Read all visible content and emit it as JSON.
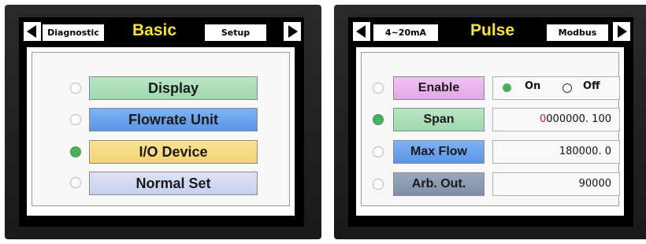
{
  "left_panel": {
    "header": {
      "prev_tab": "Diagnostic",
      "title": "Basic",
      "next_tab": "Setup"
    },
    "menu": [
      {
        "label": "Display",
        "selected": false,
        "color": "#a8dfb6"
      },
      {
        "label": "Flowrate Unit",
        "selected": false,
        "color": "#6aa3ee"
      },
      {
        "label": "I/O Device",
        "selected": true,
        "color": "#f7da83"
      },
      {
        "label": "Normal Set",
        "selected": false,
        "color": "#d3daf2"
      }
    ]
  },
  "right_panel": {
    "header": {
      "prev_tab": "4~20mA",
      "title": "Pulse",
      "next_tab": "Modbus"
    },
    "rows": [
      {
        "label": "Enable",
        "selected": false,
        "color": "#eab5ee"
      },
      {
        "label": "Span",
        "selected": true,
        "color": "#a8dfb6"
      },
      {
        "label": "Max Flow",
        "selected": false,
        "color": "#6aa3ee"
      },
      {
        "label": "Arb. Out.",
        "selected": false,
        "color": "#8a98b1"
      }
    ],
    "enable_options": {
      "on_label": "On",
      "off_label": "Off",
      "selected": "On"
    },
    "span_value": {
      "cursor_digit": "0",
      "rest": "000000. 100"
    },
    "max_flow_value": "180000. 0",
    "arb_out_value": "90000"
  },
  "colors": {
    "title_yellow": "#f5e23a",
    "radio_active": "#4ab05e",
    "cursor_red": "#d22020"
  }
}
